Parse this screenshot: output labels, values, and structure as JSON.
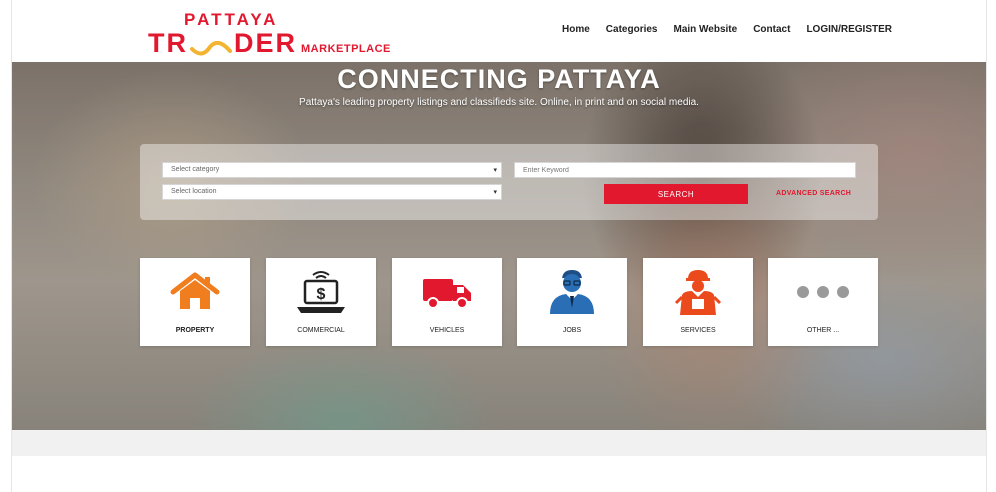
{
  "brand": {
    "top": "PATTAYA",
    "main_left": "TR",
    "main_right": "DER",
    "sub": "MARKETPLACE",
    "color": "#e2182f",
    "accent": "#f2b431"
  },
  "nav": {
    "items": [
      {
        "label": "Home"
      },
      {
        "label": "Categories"
      },
      {
        "label": "Main Website"
      },
      {
        "label": "Contact"
      },
      {
        "label": "LOGIN/REGISTER"
      }
    ]
  },
  "hero": {
    "title": "CONNECTING PATTAYA",
    "subtitle": "Pattaya's leading property listings and classifieds site. Online, in print and on social media."
  },
  "search": {
    "category_value": "Select category",
    "location_value": "Select location",
    "caret": "▾",
    "keyword_placeholder": "Enter Keyword",
    "search_label": "SEARCH",
    "advanced_label": "ADVANCED SEARCH"
  },
  "categories": [
    {
      "label": "PROPERTY",
      "icon": "house-icon",
      "color": "#f07d1e"
    },
    {
      "label": "COMMERCIAL",
      "icon": "laptop-dollar-icon",
      "color": "#222222"
    },
    {
      "label": "VEHICLES",
      "icon": "truck-icon",
      "color": "#e2182f"
    },
    {
      "label": "JOBS",
      "icon": "businessman-icon",
      "color": "#2a6fb5"
    },
    {
      "label": "SERVICES",
      "icon": "worker-icon",
      "color": "#ea4a1c"
    },
    {
      "label": "OTHER ...",
      "icon": "more-dots-icon",
      "color": "#9a9a9a"
    }
  ]
}
